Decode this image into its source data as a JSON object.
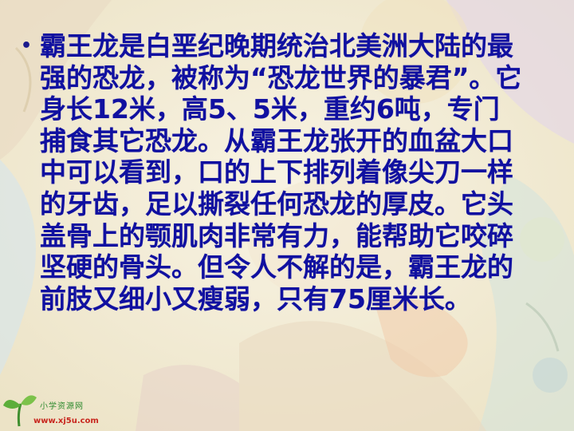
{
  "slide": {
    "bullet_symbol": "•",
    "paragraph": "霸王龙是白垩纪晚期统治北美洲大陆的最强的恐龙，被称为“恐龙世界的暴君”。它身长12米，高5、5米，重约6吨，专门捕食其它恐龙。从霸王龙张开的血盆大口中可以看到，口的上下排列着像尖刀一样的牙齿，足以撕裂任何恐龙的厚皮。它头盖骨上的颚肌肉非常有力，能帮助它咬碎坚硬的骨头。但令人不解的是，霸王龙的前肢又细小又瘦弱，只有75厘米长。",
    "text_color": "#1010a0"
  },
  "logo": {
    "name": "小学资源网",
    "url": "www.xj5u.com",
    "icon": "green-sprout-icon"
  },
  "colors": {
    "background": "#f4efd9",
    "logo_green": "#2f8a2f",
    "logo_red": "#c8261e"
  }
}
